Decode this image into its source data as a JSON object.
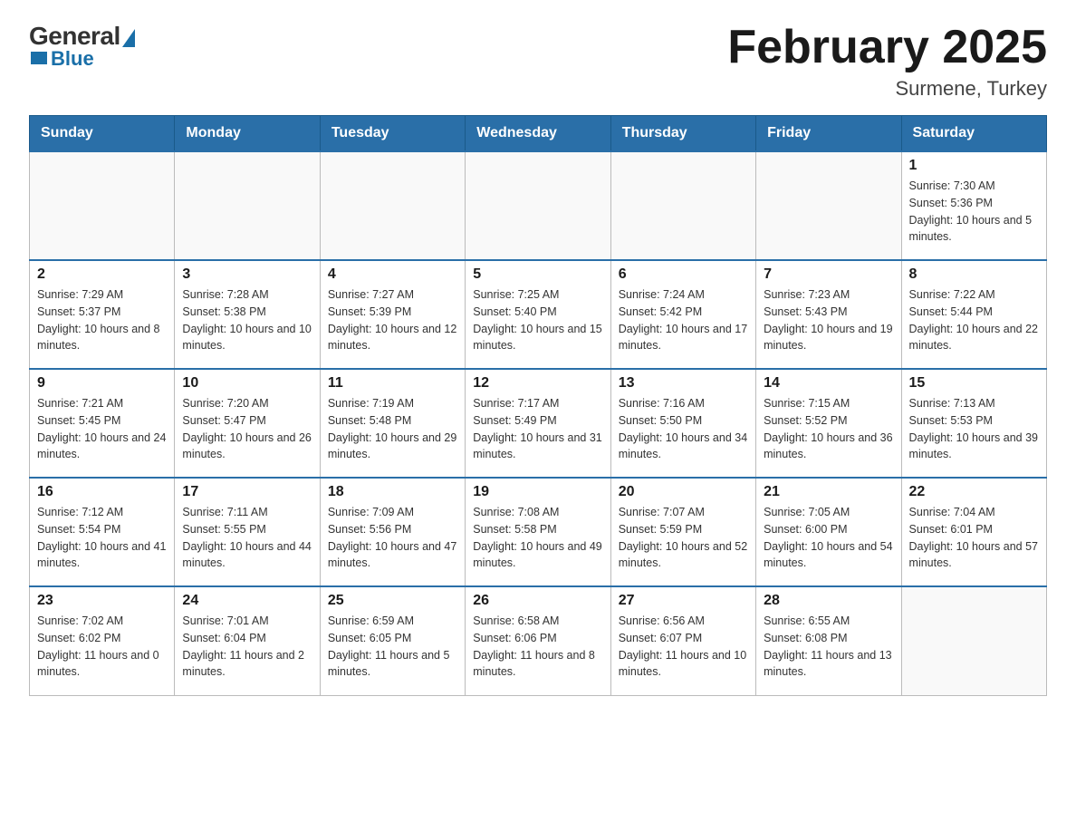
{
  "logo": {
    "general": "General",
    "blue": "Blue"
  },
  "title": "February 2025",
  "location": "Surmene, Turkey",
  "days_of_week": [
    "Sunday",
    "Monday",
    "Tuesday",
    "Wednesday",
    "Thursday",
    "Friday",
    "Saturday"
  ],
  "weeks": [
    [
      {
        "day": "",
        "info": ""
      },
      {
        "day": "",
        "info": ""
      },
      {
        "day": "",
        "info": ""
      },
      {
        "day": "",
        "info": ""
      },
      {
        "day": "",
        "info": ""
      },
      {
        "day": "",
        "info": ""
      },
      {
        "day": "1",
        "info": "Sunrise: 7:30 AM\nSunset: 5:36 PM\nDaylight: 10 hours and 5 minutes."
      }
    ],
    [
      {
        "day": "2",
        "info": "Sunrise: 7:29 AM\nSunset: 5:37 PM\nDaylight: 10 hours and 8 minutes."
      },
      {
        "day": "3",
        "info": "Sunrise: 7:28 AM\nSunset: 5:38 PM\nDaylight: 10 hours and 10 minutes."
      },
      {
        "day": "4",
        "info": "Sunrise: 7:27 AM\nSunset: 5:39 PM\nDaylight: 10 hours and 12 minutes."
      },
      {
        "day": "5",
        "info": "Sunrise: 7:25 AM\nSunset: 5:40 PM\nDaylight: 10 hours and 15 minutes."
      },
      {
        "day": "6",
        "info": "Sunrise: 7:24 AM\nSunset: 5:42 PM\nDaylight: 10 hours and 17 minutes."
      },
      {
        "day": "7",
        "info": "Sunrise: 7:23 AM\nSunset: 5:43 PM\nDaylight: 10 hours and 19 minutes."
      },
      {
        "day": "8",
        "info": "Sunrise: 7:22 AM\nSunset: 5:44 PM\nDaylight: 10 hours and 22 minutes."
      }
    ],
    [
      {
        "day": "9",
        "info": "Sunrise: 7:21 AM\nSunset: 5:45 PM\nDaylight: 10 hours and 24 minutes."
      },
      {
        "day": "10",
        "info": "Sunrise: 7:20 AM\nSunset: 5:47 PM\nDaylight: 10 hours and 26 minutes."
      },
      {
        "day": "11",
        "info": "Sunrise: 7:19 AM\nSunset: 5:48 PM\nDaylight: 10 hours and 29 minutes."
      },
      {
        "day": "12",
        "info": "Sunrise: 7:17 AM\nSunset: 5:49 PM\nDaylight: 10 hours and 31 minutes."
      },
      {
        "day": "13",
        "info": "Sunrise: 7:16 AM\nSunset: 5:50 PM\nDaylight: 10 hours and 34 minutes."
      },
      {
        "day": "14",
        "info": "Sunrise: 7:15 AM\nSunset: 5:52 PM\nDaylight: 10 hours and 36 minutes."
      },
      {
        "day": "15",
        "info": "Sunrise: 7:13 AM\nSunset: 5:53 PM\nDaylight: 10 hours and 39 minutes."
      }
    ],
    [
      {
        "day": "16",
        "info": "Sunrise: 7:12 AM\nSunset: 5:54 PM\nDaylight: 10 hours and 41 minutes."
      },
      {
        "day": "17",
        "info": "Sunrise: 7:11 AM\nSunset: 5:55 PM\nDaylight: 10 hours and 44 minutes."
      },
      {
        "day": "18",
        "info": "Sunrise: 7:09 AM\nSunset: 5:56 PM\nDaylight: 10 hours and 47 minutes."
      },
      {
        "day": "19",
        "info": "Sunrise: 7:08 AM\nSunset: 5:58 PM\nDaylight: 10 hours and 49 minutes."
      },
      {
        "day": "20",
        "info": "Sunrise: 7:07 AM\nSunset: 5:59 PM\nDaylight: 10 hours and 52 minutes."
      },
      {
        "day": "21",
        "info": "Sunrise: 7:05 AM\nSunset: 6:00 PM\nDaylight: 10 hours and 54 minutes."
      },
      {
        "day": "22",
        "info": "Sunrise: 7:04 AM\nSunset: 6:01 PM\nDaylight: 10 hours and 57 minutes."
      }
    ],
    [
      {
        "day": "23",
        "info": "Sunrise: 7:02 AM\nSunset: 6:02 PM\nDaylight: 11 hours and 0 minutes."
      },
      {
        "day": "24",
        "info": "Sunrise: 7:01 AM\nSunset: 6:04 PM\nDaylight: 11 hours and 2 minutes."
      },
      {
        "day": "25",
        "info": "Sunrise: 6:59 AM\nSunset: 6:05 PM\nDaylight: 11 hours and 5 minutes."
      },
      {
        "day": "26",
        "info": "Sunrise: 6:58 AM\nSunset: 6:06 PM\nDaylight: 11 hours and 8 minutes."
      },
      {
        "day": "27",
        "info": "Sunrise: 6:56 AM\nSunset: 6:07 PM\nDaylight: 11 hours and 10 minutes."
      },
      {
        "day": "28",
        "info": "Sunrise: 6:55 AM\nSunset: 6:08 PM\nDaylight: 11 hours and 13 minutes."
      },
      {
        "day": "",
        "info": ""
      }
    ]
  ]
}
